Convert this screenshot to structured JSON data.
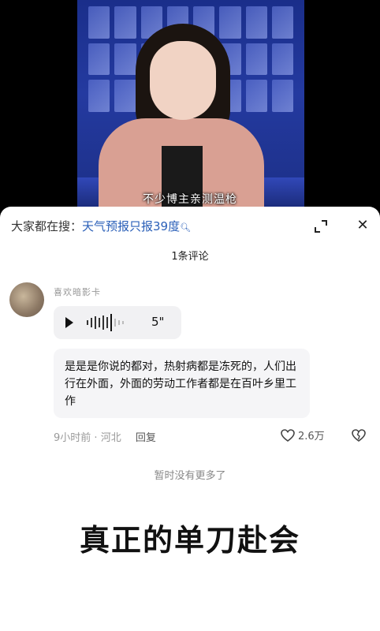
{
  "video": {
    "subtitle": "不少博主亲测温枪"
  },
  "sheet": {
    "search_prefix": "大家都在搜：",
    "search_keyword": "天气预报只报39度",
    "comment_count": "1条评论"
  },
  "comment": {
    "username": "喜欢暗影卡",
    "voice_duration": "5\"",
    "text": "是是是你说的都对，热射病都是冻死的，人们出行在外面，外面的劳动工作者都是在百叶乡里工作",
    "time": "9小时前",
    "location": "河北",
    "reply_label": "回复",
    "likes": "2.6万"
  },
  "footer": {
    "no_more": "暂时没有更多了"
  },
  "caption": "真正的单刀赴会",
  "colors": {
    "keyword": "#2a5fb8",
    "studio": "#243aa0"
  }
}
